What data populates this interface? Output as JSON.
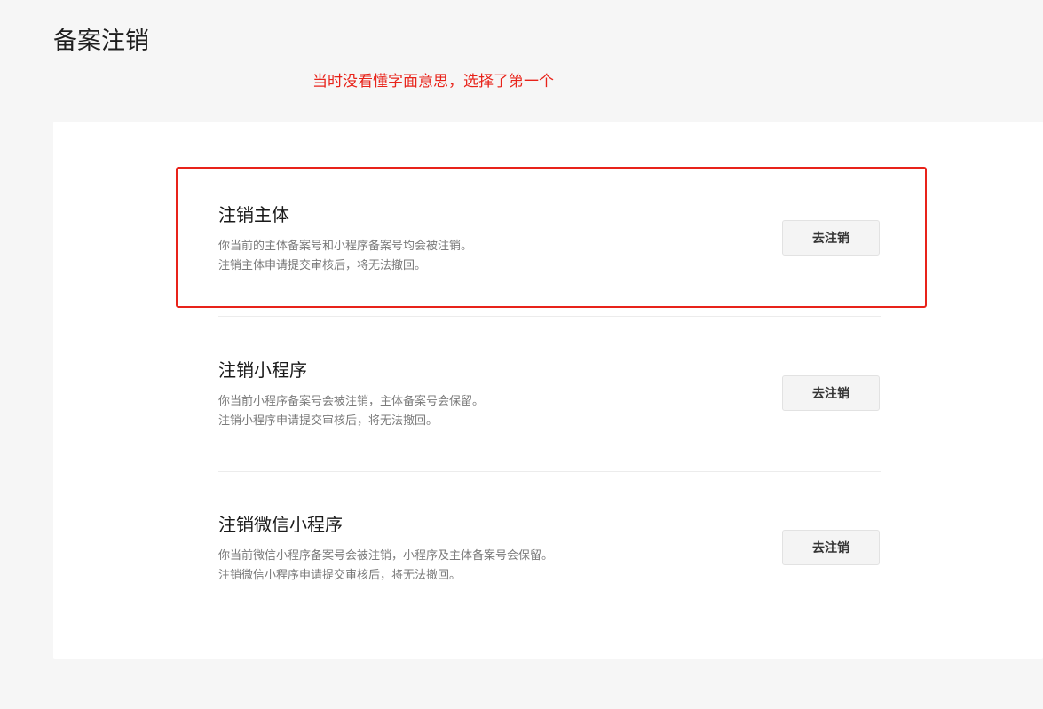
{
  "page": {
    "title": "备案注销",
    "annotation": "当时没看懂字面意思，选择了第一个"
  },
  "options": [
    {
      "title": "注销主体",
      "desc_line1": "你当前的主体备案号和小程序备案号均会被注销。",
      "desc_line2": "注销主体申请提交审核后，将无法撤回。",
      "button_label": "去注销"
    },
    {
      "title": "注销小程序",
      "desc_line1": "你当前小程序备案号会被注销，主体备案号会保留。",
      "desc_line2": "注销小程序申请提交审核后，将无法撤回。",
      "button_label": "去注销"
    },
    {
      "title": "注销微信小程序",
      "desc_line1": "你当前微信小程序备案号会被注销，小程序及主体备案号会保留。",
      "desc_line2": "注销微信小程序申请提交审核后，将无法撤回。",
      "button_label": "去注销"
    }
  ],
  "colors": {
    "annotation": "#e8231a",
    "highlight_box": "#e8231a"
  }
}
